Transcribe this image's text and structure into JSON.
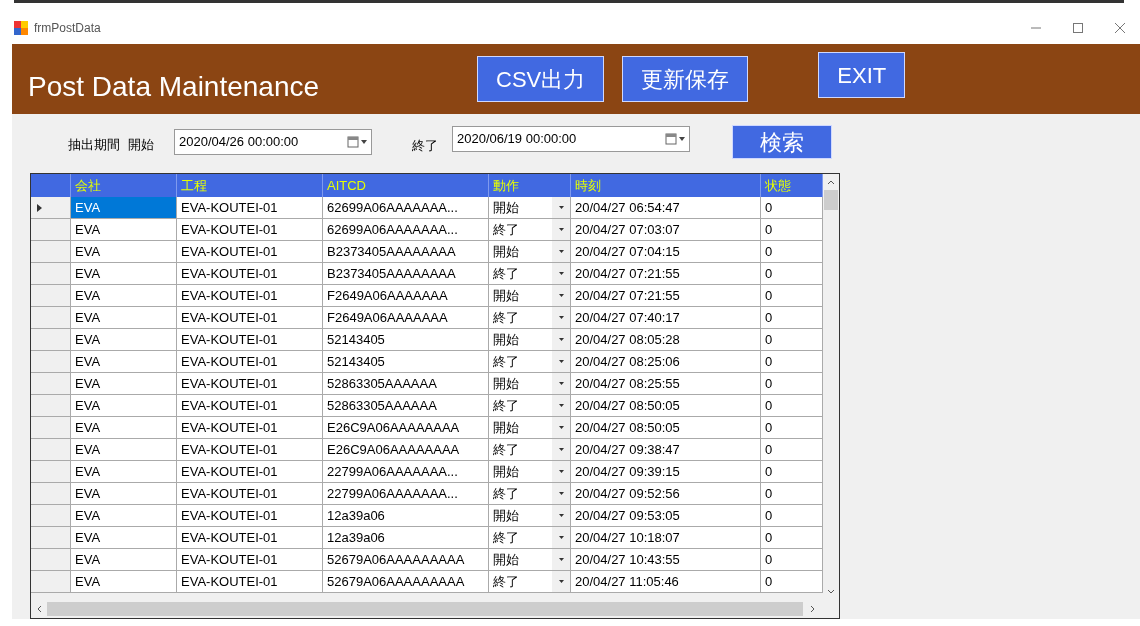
{
  "window": {
    "title": "frmPostData"
  },
  "header": {
    "title": "Post Data Maintenance",
    "buttons": [
      "CSV出力",
      "更新保存",
      "EXIT"
    ]
  },
  "filter": {
    "label": "抽出期間",
    "start_label": "開始",
    "start_value": "2020/04/26 00:00:00",
    "end_label": "終了",
    "end_value": "2020/06/19 00:00:00",
    "search_button": "検索"
  },
  "table": {
    "columns": [
      "会社",
      "工程",
      "AITCD",
      "動作",
      "時刻",
      "状態"
    ],
    "rows": [
      {
        "selected": true,
        "cells": [
          "EVA",
          "EVA-KOUTEI-01",
          "62699A06AAAAAAA...",
          "開始",
          "20/04/27 06:54:47",
          "0"
        ]
      },
      {
        "selected": false,
        "cells": [
          "EVA",
          "EVA-KOUTEI-01",
          "62699A06AAAAAAA...",
          "終了",
          "20/04/27 07:03:07",
          "0"
        ]
      },
      {
        "selected": false,
        "cells": [
          "EVA",
          "EVA-KOUTEI-01",
          "B2373405AAAAAAAA",
          "開始",
          "20/04/27 07:04:15",
          "0"
        ]
      },
      {
        "selected": false,
        "cells": [
          "EVA",
          "EVA-KOUTEI-01",
          "B2373405AAAAAAAA",
          "終了",
          "20/04/27 07:21:55",
          "0"
        ]
      },
      {
        "selected": false,
        "cells": [
          "EVA",
          "EVA-KOUTEI-01",
          "F2649A06AAAAAAA",
          "開始",
          "20/04/27 07:21:55",
          "0"
        ]
      },
      {
        "selected": false,
        "cells": [
          "EVA",
          "EVA-KOUTEI-01",
          "F2649A06AAAAAAA",
          "終了",
          "20/04/27 07:40:17",
          "0"
        ]
      },
      {
        "selected": false,
        "cells": [
          "EVA",
          "EVA-KOUTEI-01",
          "52143405",
          "開始",
          "20/04/27 08:05:28",
          "0"
        ]
      },
      {
        "selected": false,
        "cells": [
          "EVA",
          "EVA-KOUTEI-01",
          "52143405",
          "終了",
          "20/04/27 08:25:06",
          "0"
        ]
      },
      {
        "selected": false,
        "cells": [
          "EVA",
          "EVA-KOUTEI-01",
          "52863305AAAAAA",
          "開始",
          "20/04/27 08:25:55",
          "0"
        ]
      },
      {
        "selected": false,
        "cells": [
          "EVA",
          "EVA-KOUTEI-01",
          "52863305AAAAAA",
          "終了",
          "20/04/27 08:50:05",
          "0"
        ]
      },
      {
        "selected": false,
        "cells": [
          "EVA",
          "EVA-KOUTEI-01",
          "E26C9A06AAAAAAAA",
          "開始",
          "20/04/27 08:50:05",
          "0"
        ]
      },
      {
        "selected": false,
        "cells": [
          "EVA",
          "EVA-KOUTEI-01",
          "E26C9A06AAAAAAAA",
          "終了",
          "20/04/27 09:38:47",
          "0"
        ]
      },
      {
        "selected": false,
        "cells": [
          "EVA",
          "EVA-KOUTEI-01",
          "22799A06AAAAAAA...",
          "開始",
          "20/04/27 09:39:15",
          "0"
        ]
      },
      {
        "selected": false,
        "cells": [
          "EVA",
          "EVA-KOUTEI-01",
          "22799A06AAAAAAA...",
          "終了",
          "20/04/27 09:52:56",
          "0"
        ]
      },
      {
        "selected": false,
        "cells": [
          "EVA",
          "EVA-KOUTEI-01",
          "12a39a06",
          "開始",
          "20/04/27 09:53:05",
          "0"
        ]
      },
      {
        "selected": false,
        "cells": [
          "EVA",
          "EVA-KOUTEI-01",
          "12a39a06",
          "終了",
          "20/04/27 10:18:07",
          "0"
        ]
      },
      {
        "selected": false,
        "cells": [
          "EVA",
          "EVA-KOUTEI-01",
          "52679A06AAAAAAAAA",
          "開始",
          "20/04/27 10:43:55",
          "0"
        ]
      },
      {
        "selected": false,
        "cells": [
          "EVA",
          "EVA-KOUTEI-01",
          "52679A06AAAAAAAAA",
          "終了",
          "20/04/27 11:05:46",
          "0"
        ]
      }
    ]
  }
}
